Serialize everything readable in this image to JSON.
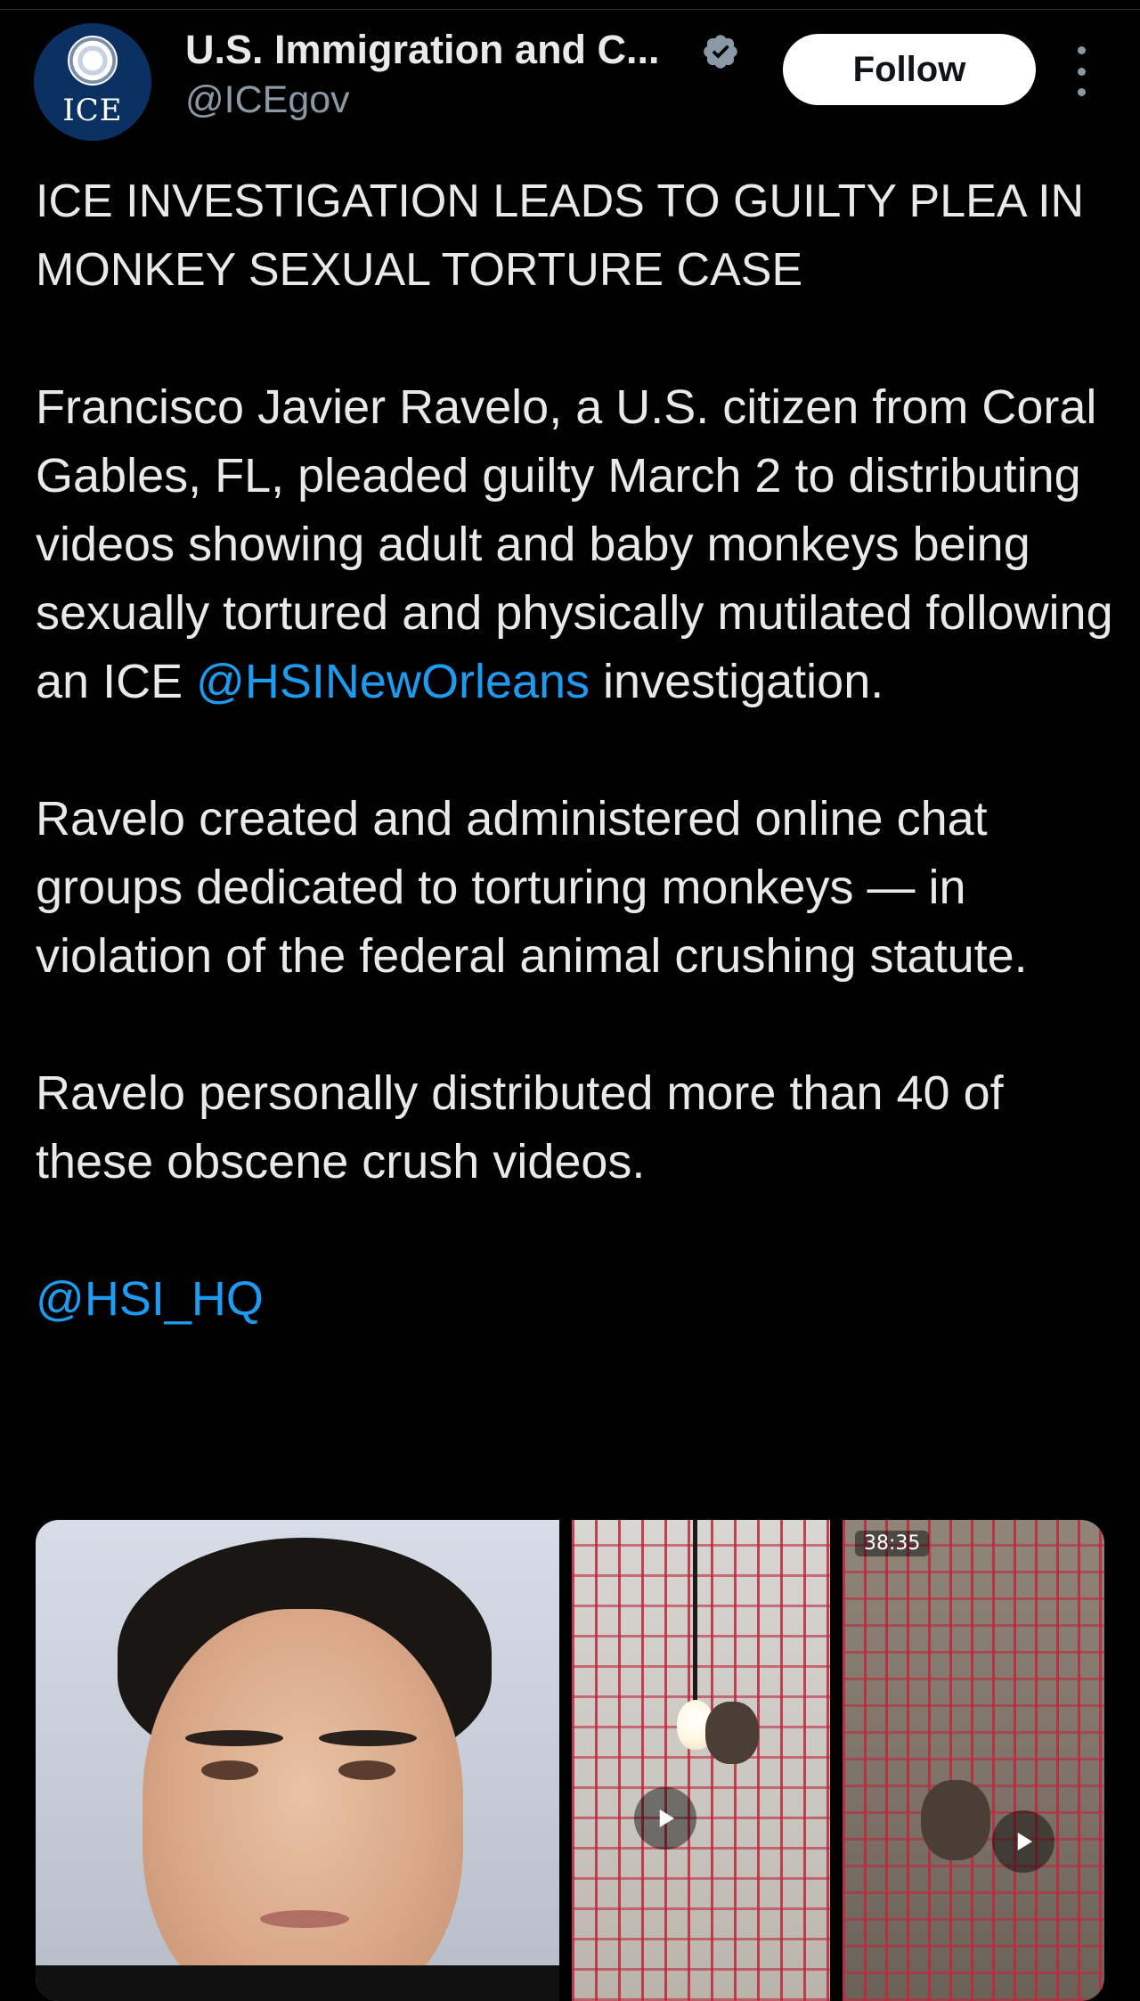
{
  "account": {
    "display_name": "U.S. Immigration and C...",
    "handle": "@ICEgov",
    "verified": true,
    "avatar_text": "ICE",
    "verified_icon": "verified-badge-icon"
  },
  "actions": {
    "follow_label": "Follow",
    "more_icon": "more-vertical-icon"
  },
  "tweet": {
    "headline": "ICE INVESTIGATION LEADS TO GUILTY PLEA IN MONKEY SEXUAL TORTURE CASE",
    "p1_text": "Francisco Javier Ravelo, a U.S. citizen from Coral Gables, FL, pleaded guilty March 2 to distributing videos showing adult and baby monkeys being sexually tortured and physically mutilated following an ICE ",
    "p1_mention": "@HSINewOrleans",
    "p1_after": " investigation.",
    "p2": "Ravelo created and administered online chat groups dedicated to torturing monkeys — in violation of the federal animal crushing statute.",
    "p3": "Ravelo personally distributed more than 40 of these obscene crush videos.",
    "p4_mention": "@HSI_HQ"
  },
  "media": {
    "video_2_duration": "38:35",
    "play_icon": "play-icon"
  },
  "colors": {
    "background": "#000000",
    "text": "#e7e9ea",
    "secondary": "#8b98a5",
    "link": "#1d9bf0",
    "follow_bg": "#ffffff"
  }
}
